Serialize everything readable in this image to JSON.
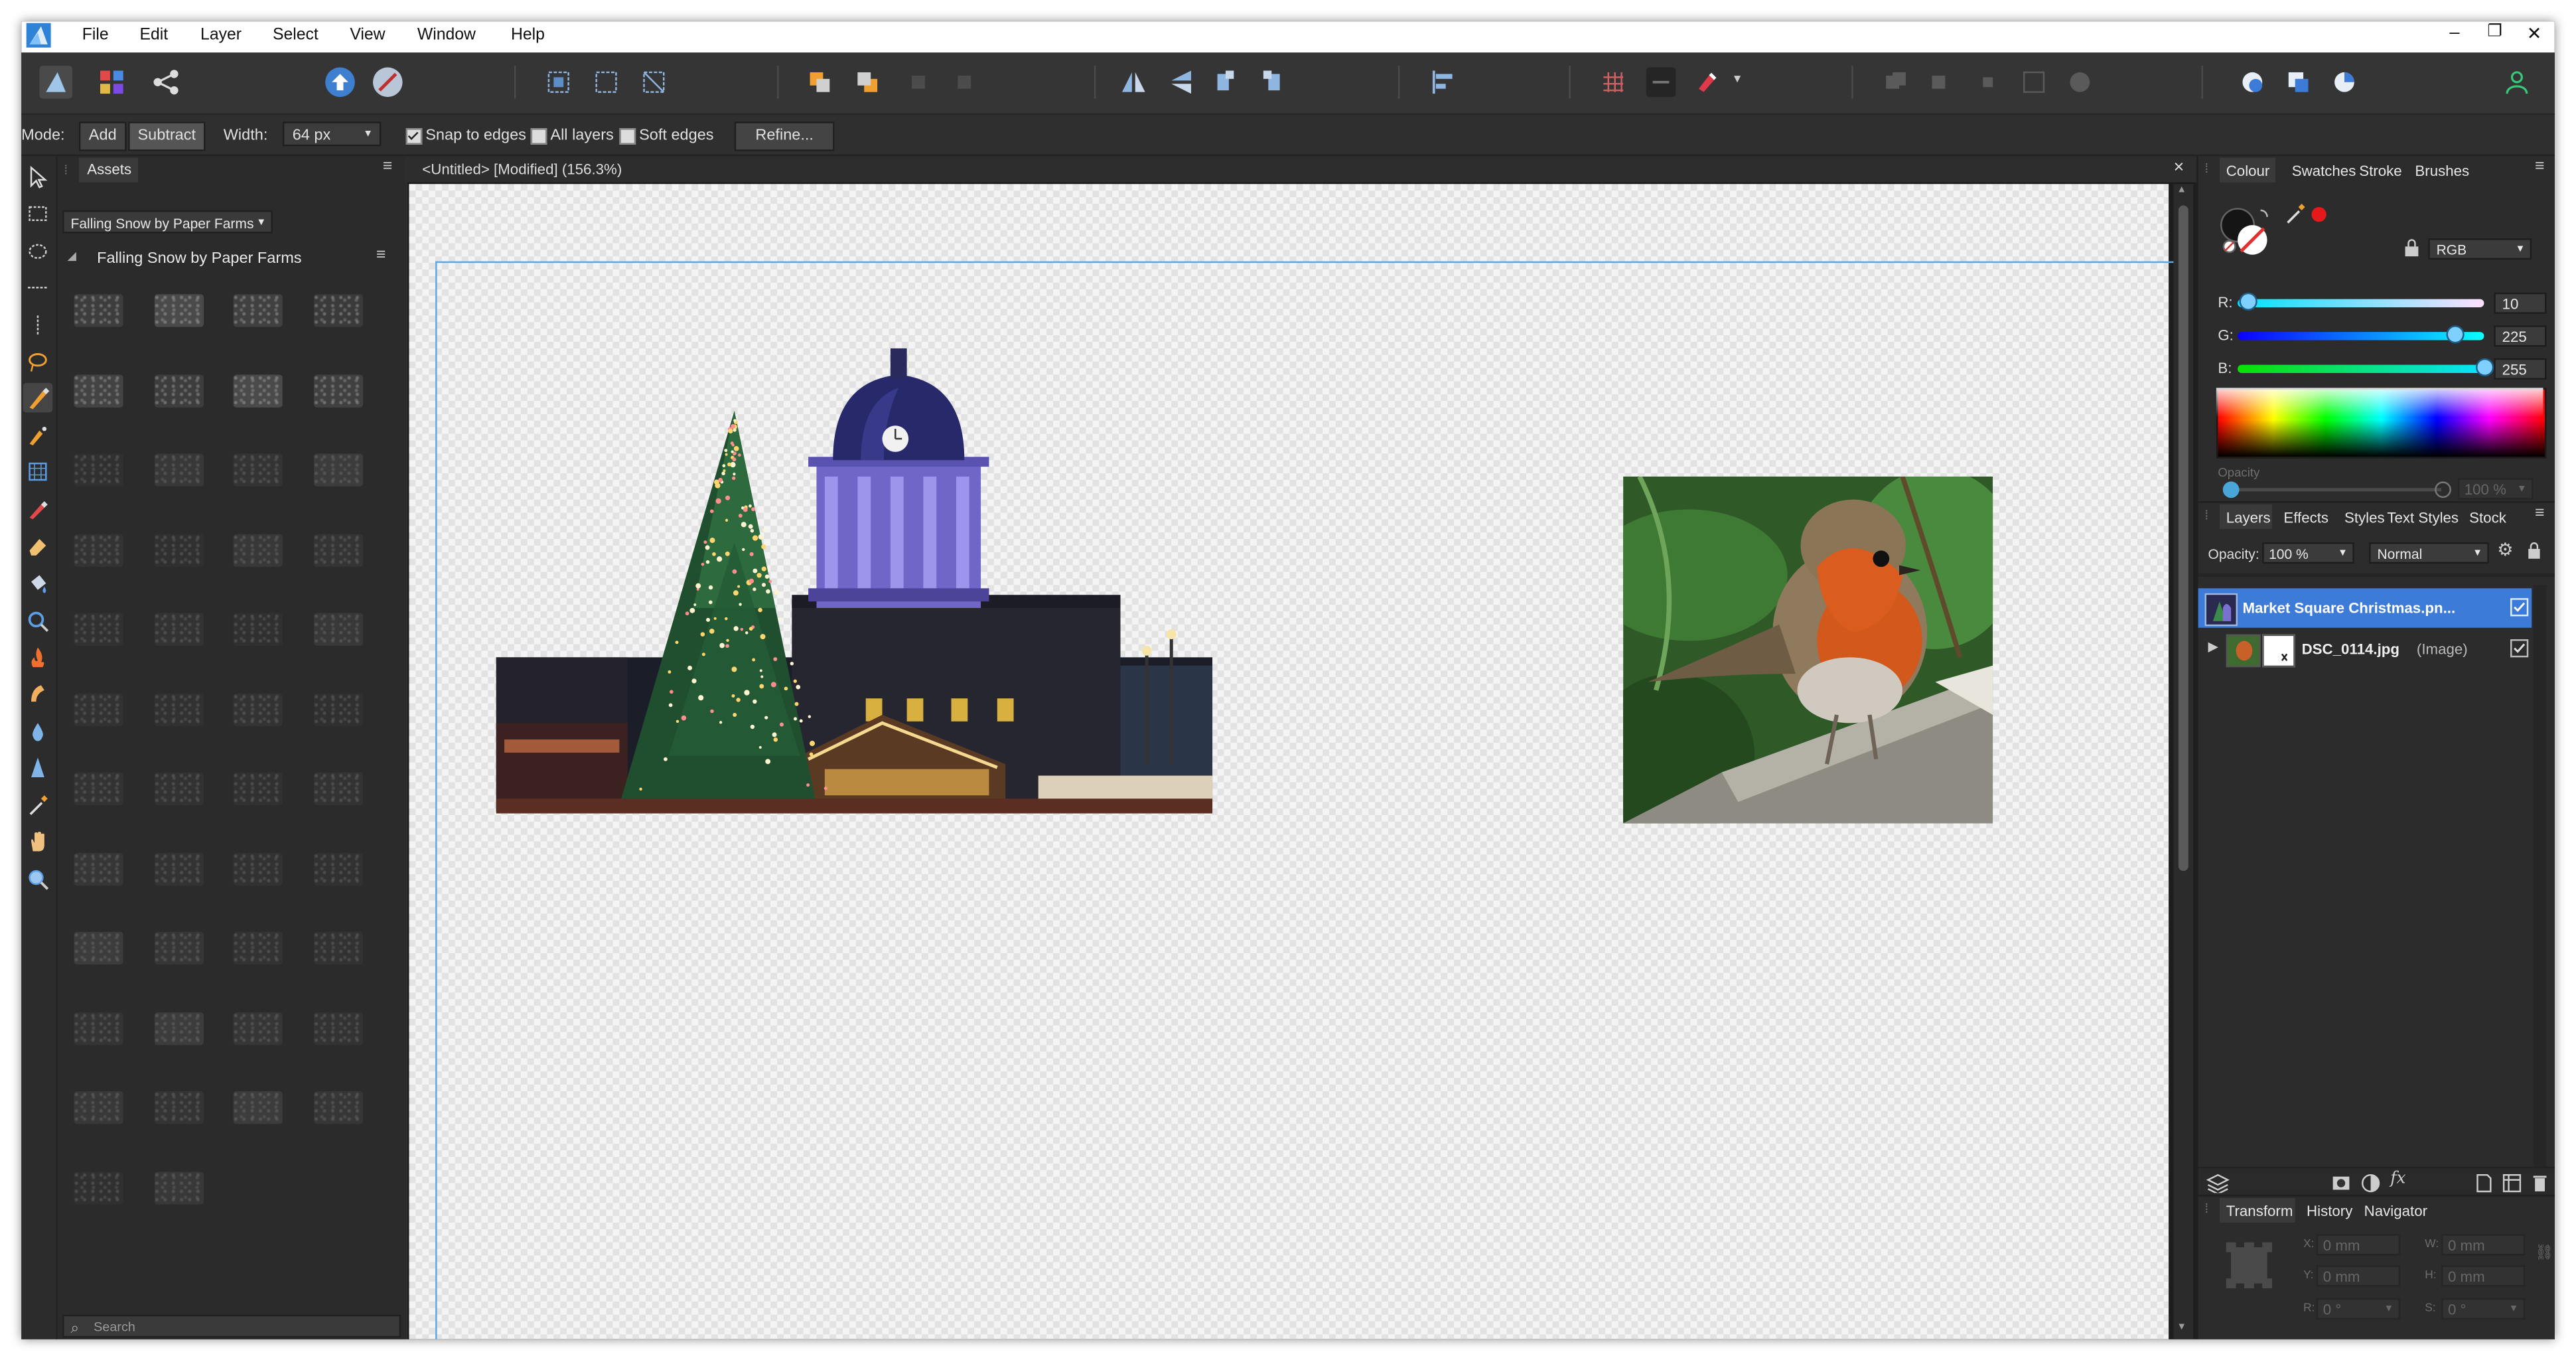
{
  "menubar": {
    "items": [
      "File",
      "Edit",
      "Layer",
      "Select",
      "View",
      "Window",
      "Help"
    ],
    "window_controls": {
      "minimize": "–",
      "restore": "❐",
      "close": "✕"
    }
  },
  "context_bar": {
    "mode_label": "Mode:",
    "mode_add": "Add",
    "mode_subtract": "Subtract",
    "width_label": "Width:",
    "width_value": "64 px",
    "snap_to_edges": "Snap to edges",
    "all_layers": "All layers",
    "soft_edges": "Soft edges",
    "refine_button": "Refine...",
    "snap_checked": true,
    "all_layers_checked": false,
    "soft_edges_checked": false
  },
  "assets_panel": {
    "tab": "Assets",
    "category_dropdown": "Falling Snow by Paper Farms",
    "group_title": "Falling Snow by Paper Farms",
    "search_placeholder": "Search"
  },
  "document": {
    "tab_title": "<Untitled> [Modified] (156.3%)",
    "close": "×"
  },
  "colour_panel": {
    "tabs": [
      "Colour",
      "Swatches",
      "Stroke",
      "Brushes"
    ],
    "mode_dropdown": "RGB",
    "r_label": "R:",
    "r_value": "10",
    "g_label": "G:",
    "g_value": "225",
    "b_label": "B:",
    "b_value": "255",
    "opacity_label": "Opacity",
    "opacity_value": "100 %",
    "rgb": {
      "r": 10,
      "g": 225,
      "b": 255
    }
  },
  "layers_panel": {
    "tabs": [
      "Layers",
      "Effects",
      "Styles",
      "Text Styles",
      "Stock"
    ],
    "opacity_label": "Opacity:",
    "opacity_value": "100 %",
    "blend_mode": "Normal",
    "layers": [
      {
        "name": "Market Square Christmas.pn...",
        "type": ""
      },
      {
        "name": "DSC_0114.jpg",
        "type": "(Image)"
      }
    ]
  },
  "transform_panel": {
    "tabs": [
      "Transform",
      "History",
      "Navigator"
    ],
    "x_label": "X:",
    "x_value": "0 mm",
    "y_label": "Y:",
    "y_value": "0 mm",
    "w_label": "W:",
    "w_value": "0 mm",
    "h_label": "H:",
    "h_value": "0 mm",
    "r_label": "R:",
    "r_value": "0 °",
    "s_label": "S:",
    "s_value": "0 °"
  },
  "colors": {
    "accent": "#4a90d9",
    "selection": "#3d7bd8",
    "panel_bg": "#2c2c2c",
    "toolbar_bg": "#353535"
  }
}
